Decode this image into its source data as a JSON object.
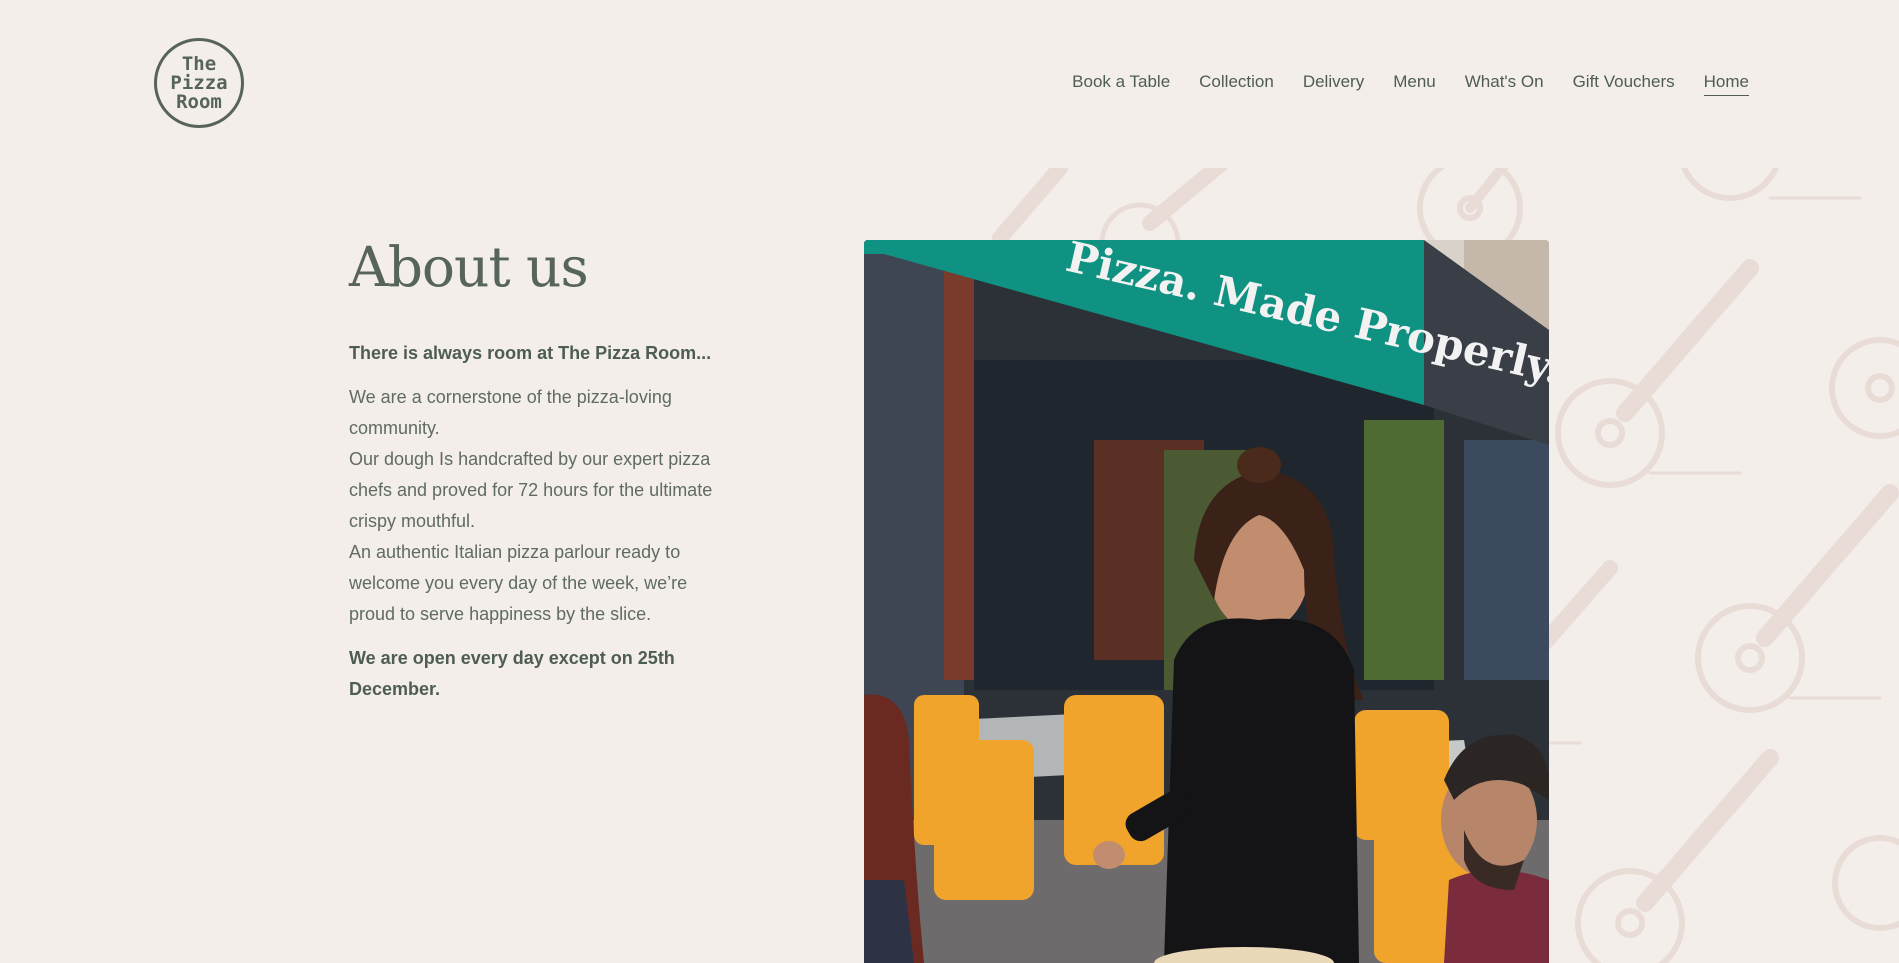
{
  "logo": {
    "line1": "The",
    "line2": "Pizza",
    "line3": "Room"
  },
  "nav": {
    "items": [
      {
        "label": "Book a Table"
      },
      {
        "label": "Collection"
      },
      {
        "label": "Delivery"
      },
      {
        "label": "Menu"
      },
      {
        "label": "What's On"
      },
      {
        "label": "Gift Vouchers"
      },
      {
        "label": "Home"
      }
    ],
    "active": "Home"
  },
  "about": {
    "title": "About us",
    "lead": "There is always room at The Pizza Room...",
    "paragraph1": "We are a cornerstone of the pizza-loving community.",
    "paragraph2": "Our dough Is handcrafted by our expert pizza chefs and proved for 72 hours for the ultimate crispy mouthful.",
    "paragraph3": "An authentic Italian pizza parlour ready to welcome you every day of the week, we’re proud to serve happiness by the slice.",
    "closing": "We are open every day except on 25th December."
  },
  "photo": {
    "awning_text": "Pizza. Made Properly."
  },
  "colors": {
    "background": "#f3eeea",
    "text": "#4e5d53",
    "awning": "#0f9281",
    "pattern": "#e9dcd7"
  }
}
